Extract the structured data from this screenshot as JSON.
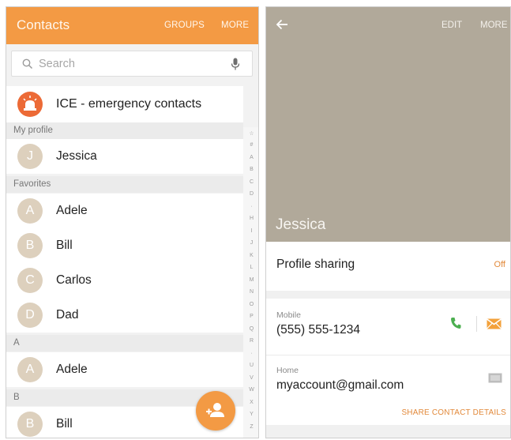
{
  "left": {
    "header": {
      "title": "Contacts",
      "groups": "GROUPS",
      "more": "MORE"
    },
    "search": {
      "placeholder": "Search"
    },
    "ice": {
      "label": "ICE - emergency contacts"
    },
    "sections": {
      "my_profile": "My profile",
      "favorites": "Favorites",
      "a": "A",
      "b": "B"
    },
    "profile": {
      "initial": "J",
      "name": "Jessica"
    },
    "favorites": [
      {
        "initial": "A",
        "name": "Adele"
      },
      {
        "initial": "B",
        "name": "Bill"
      },
      {
        "initial": "C",
        "name": "Carlos"
      },
      {
        "initial": "D",
        "name": "Dad"
      }
    ],
    "a_contacts": [
      {
        "initial": "A",
        "name": "Adele"
      }
    ],
    "b_contacts": [
      {
        "initial": "B",
        "name": "Bill"
      }
    ],
    "index": [
      "☆",
      "#",
      "A",
      "B",
      "C",
      "D",
      "·",
      "H",
      "I",
      "J",
      "K",
      "L",
      "M",
      "N",
      "O",
      "P",
      "Q",
      "R",
      "·",
      "U",
      "V",
      "W",
      "X",
      "Y",
      "Z"
    ]
  },
  "right": {
    "header": {
      "edit": "EDIT",
      "more": "MORE"
    },
    "name": "Jessica",
    "profile_sharing": {
      "label": "Profile sharing",
      "value": "Off"
    },
    "mobile": {
      "label": "Mobile",
      "value": "(555) 555-1234"
    },
    "home": {
      "label": "Home",
      "value": "myaccount@gmail.com"
    },
    "share_details": "SHARE CONTACT DETAILS"
  },
  "colors": {
    "accent": "#f39a44",
    "ice": "#ec6a36",
    "banner": "#b1a99a",
    "call": "#4caf50"
  },
  "icons": [
    "search-icon",
    "mic-icon",
    "ice-siren-icon",
    "add-contact-icon",
    "back-arrow-icon",
    "call-icon",
    "message-icon",
    "email-icon"
  ]
}
